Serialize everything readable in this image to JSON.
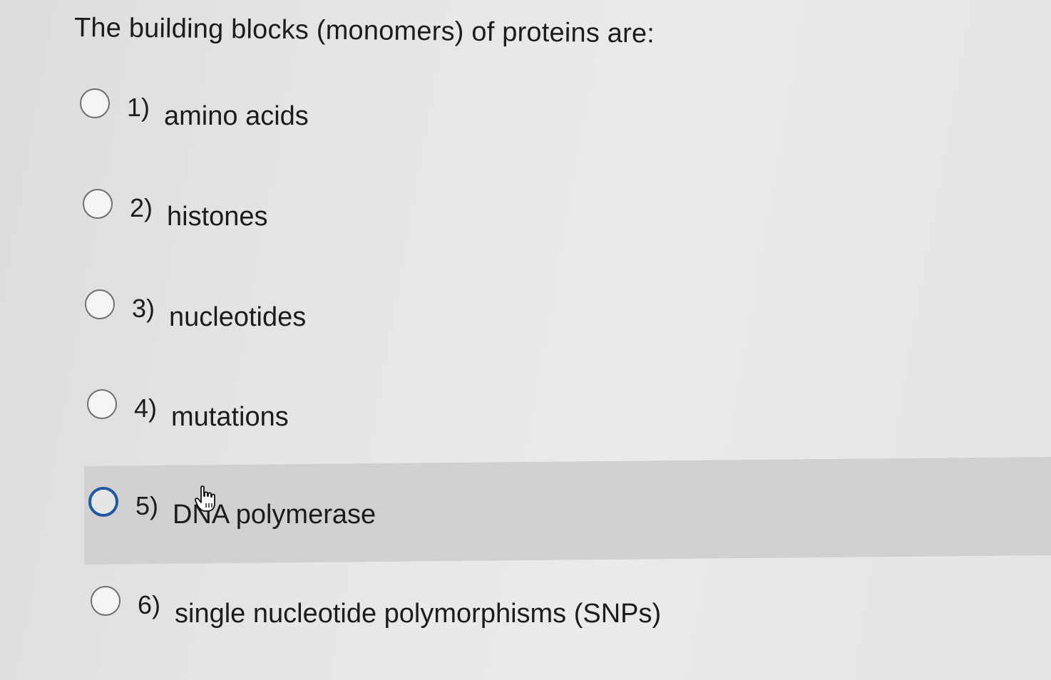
{
  "question": {
    "text": "The building blocks (monomers) of proteins are:"
  },
  "options": [
    {
      "number": "1)",
      "label": "amino acids"
    },
    {
      "number": "2)",
      "label": "histones"
    },
    {
      "number": "3)",
      "label": "nucleotides"
    },
    {
      "number": "4)",
      "label": "mutations"
    },
    {
      "number": "5)",
      "label": "DNA polymerase"
    },
    {
      "number": "6)",
      "label": "single nucleotide polymorphisms (SNPs)"
    }
  ],
  "state": {
    "focused_option": "5)",
    "cursor": "hand-pointer-icon"
  },
  "colors": {
    "focus_ring": "#1e5a9e",
    "highlight_row": "#d0d0d0",
    "background": "#e6e6e6",
    "text": "#1c1c1c"
  }
}
